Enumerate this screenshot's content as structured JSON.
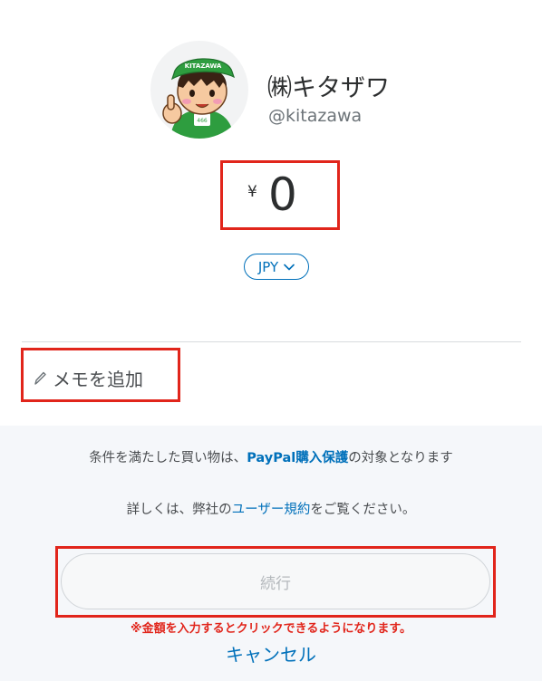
{
  "merchant": {
    "name": "㈱キタザワ",
    "handle": "@kitazawa",
    "avatar_cap_text": "KITAZAWA",
    "avatar_badge_text": "466"
  },
  "amount": {
    "currency_symbol": "¥",
    "value": "0"
  },
  "currency_select": {
    "selected": "JPY"
  },
  "memo": {
    "label": "メモを追加"
  },
  "notice": {
    "line1_prefix": "条件を満たした買い物は、",
    "line1_brand": "PayPal",
    "line1_link": "購入保護",
    "line1_suffix": "の対象となります",
    "line2_prefix": "詳しくは、弊社の",
    "line2_link": "ユーザー規約",
    "line2_suffix": "をご覧ください。"
  },
  "actions": {
    "continue_label": "続行",
    "enable_note": "※金額を入力するとクリックできるようになります。",
    "cancel_label": "キャンセル"
  },
  "colors": {
    "paypal_blue": "#0070ba",
    "highlight_red": "#e1251b",
    "mascot_green": "#2e9d3f"
  }
}
